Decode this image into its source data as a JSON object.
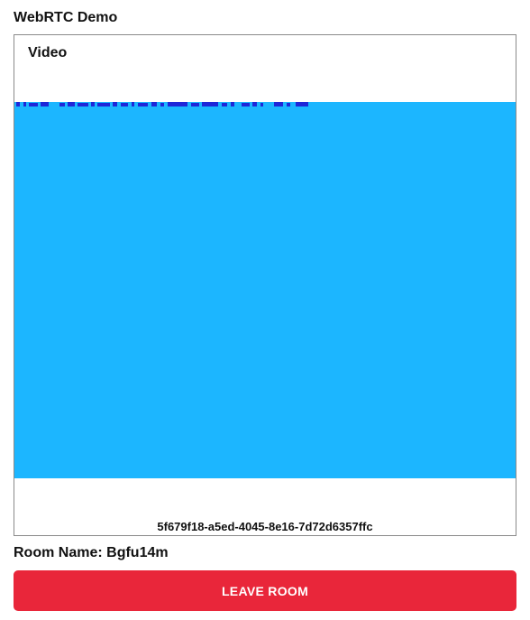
{
  "app": {
    "title": "WebRTC Demo"
  },
  "video": {
    "heading": "Video",
    "stream_id": "5f679f18-a5ed-4045-8e16-7d72d6357ffc",
    "background_color": "#1cb6ff",
    "artifact_color": "#1f27d8"
  },
  "room": {
    "label": "Room Name:",
    "name": "Bgfu14m"
  },
  "actions": {
    "leave_label": "LEAVE ROOM",
    "leave_color": "#e9263a"
  }
}
